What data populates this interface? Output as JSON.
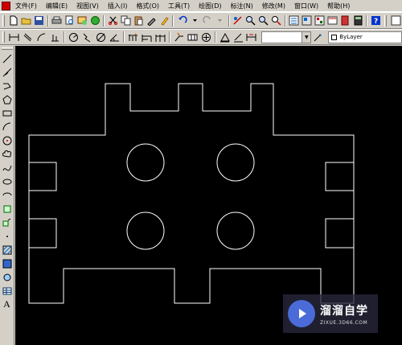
{
  "menubar": {
    "items": [
      {
        "label": "文件(F)"
      },
      {
        "label": "编辑(E)"
      },
      {
        "label": "视图(V)"
      },
      {
        "label": "插入(I)"
      },
      {
        "label": "格式(O)"
      },
      {
        "label": "工具(T)"
      },
      {
        "label": "绘图(D)"
      },
      {
        "label": "标注(N)"
      },
      {
        "label": "修改(M)"
      },
      {
        "label": "窗口(W)"
      },
      {
        "label": "帮助(H)"
      }
    ]
  },
  "layer_toolbar": {
    "layer_value": "ByLayer"
  },
  "left_toolbar": {
    "text_tool_glyph": "A"
  },
  "watermark": {
    "title": "溜溜自学",
    "subtitle": "ZIXUE.3D66.COM"
  },
  "colors": {
    "canvas_background": "#000000",
    "drawing_lines": "#ffffff",
    "ui_face": "#d4d0c8"
  }
}
